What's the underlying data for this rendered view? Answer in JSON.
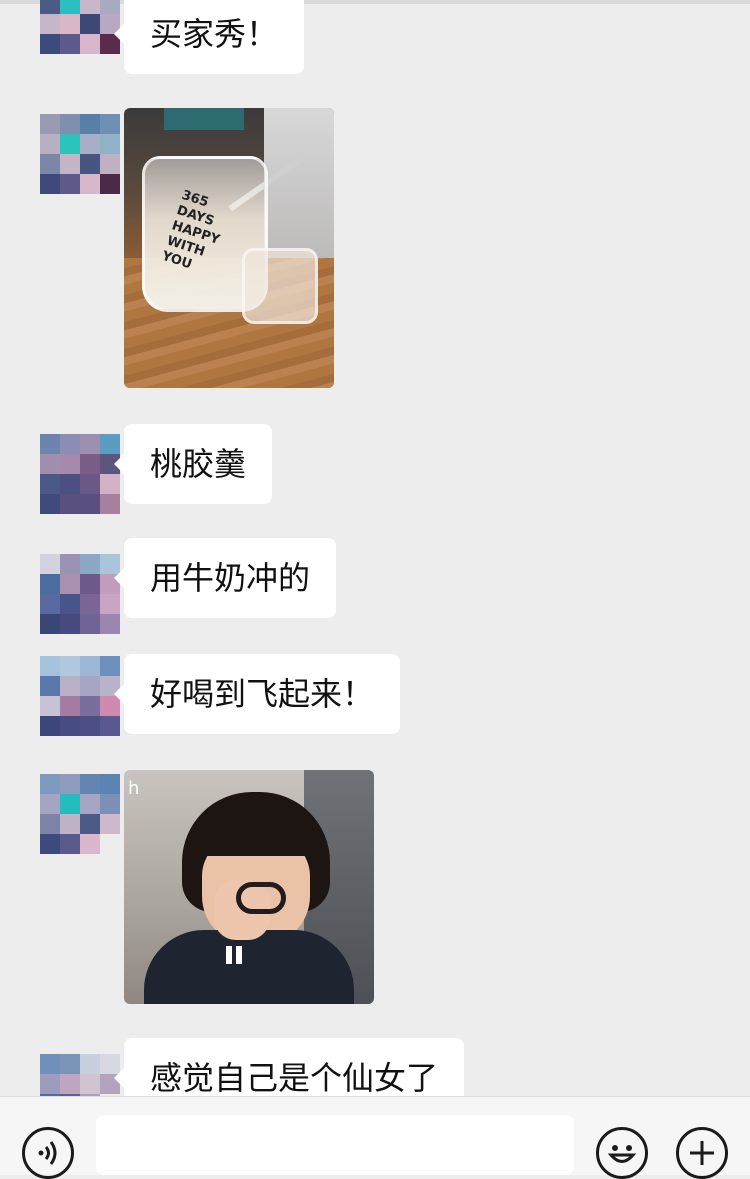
{
  "messages": [
    {
      "type": "text",
      "text": "买家秀！"
    },
    {
      "type": "image",
      "icon": "jar-photo"
    },
    {
      "type": "text",
      "text": "桃胶羹"
    },
    {
      "type": "text",
      "text": "用牛奶冲的"
    },
    {
      "type": "text",
      "text": "好喝到飞起来！"
    },
    {
      "type": "gif",
      "icon": "girl-scissors-gif",
      "overlay_text": "h"
    },
    {
      "type": "text",
      "text": "感觉自己是个仙女了"
    }
  ],
  "photo_text": {
    "jar_label": "365 DAYS HAPPY WITH YOU"
  },
  "input_bar": {
    "voice_icon": "voice-icon",
    "emoji_icon": "emoji-icon",
    "plus_icon": "plus-icon"
  },
  "colors": {
    "background": "#ededed",
    "bubble": "#ffffff",
    "input_bar": "#f6f6f6"
  }
}
